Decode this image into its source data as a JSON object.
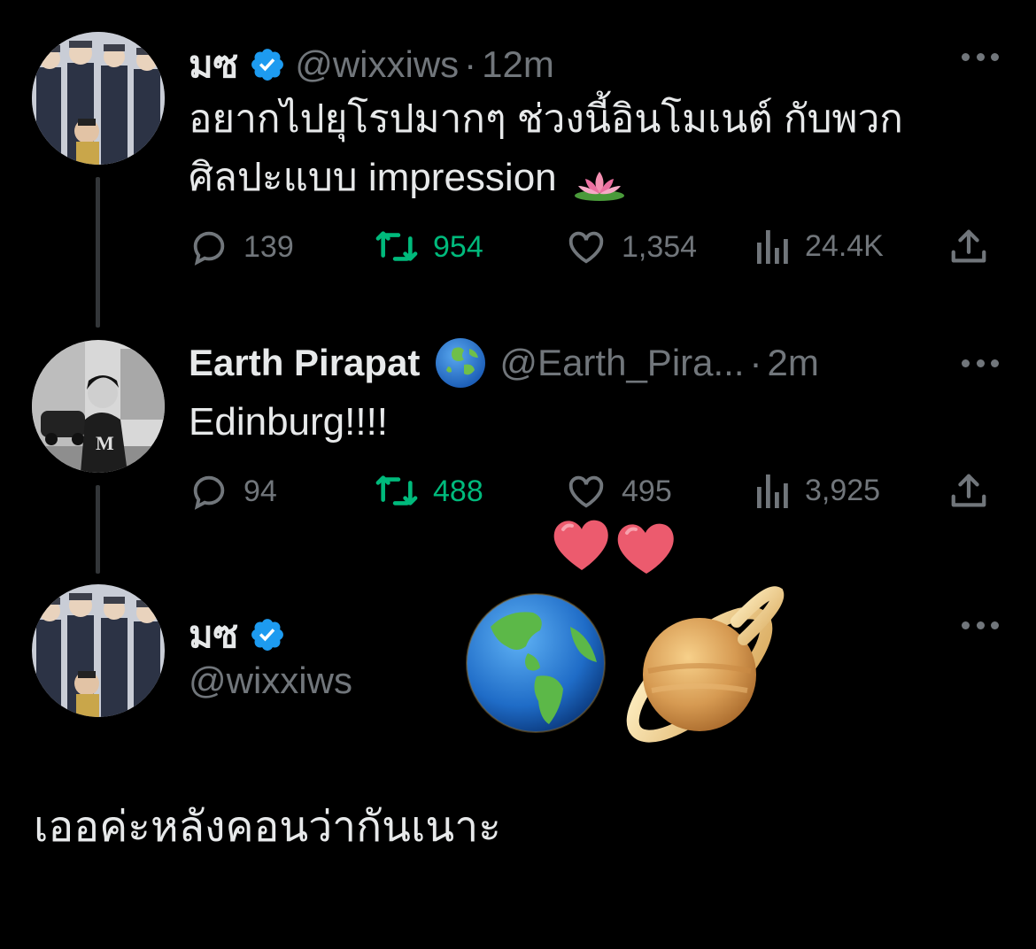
{
  "tweets": [
    {
      "name": "มซ",
      "handle": "@wixxiws",
      "dot": "·",
      "time": "12m",
      "text_line1": "อยากไปยุโรปมากๆ ช่วงนี้อินโมเนต์ กับพวก",
      "text_line2": "ศิลปะแบบ impression",
      "emoji": "lotus",
      "replies": "139",
      "retweets": "954",
      "likes": "1,354",
      "views": "24.4K"
    },
    {
      "name": "Earth Pirapat",
      "handle": "@Earth_Pira...",
      "dot": "·",
      "time": "2m",
      "text_line1": "Edinburg!!!!",
      "replies": "94",
      "retweets": "488",
      "likes": "495",
      "views": "3,925"
    },
    {
      "name": "มซ",
      "handle": "@wixxiws",
      "reply_text": "เออค่ะหลังคอนว่ากันเนาะ"
    }
  ],
  "colors": {
    "background": "#000000",
    "text": "#e7e9ea",
    "muted": "#71767b",
    "retweet": "#00ba7c",
    "verified": "#1d9bf0"
  },
  "icons": [
    "verified-icon",
    "globe-icon",
    "more-icon",
    "reply-icon",
    "retweet-icon",
    "like-icon",
    "views-icon",
    "share-icon",
    "heart-emoji",
    "earth-emoji",
    "saturn-emoji",
    "lotus-emoji"
  ]
}
